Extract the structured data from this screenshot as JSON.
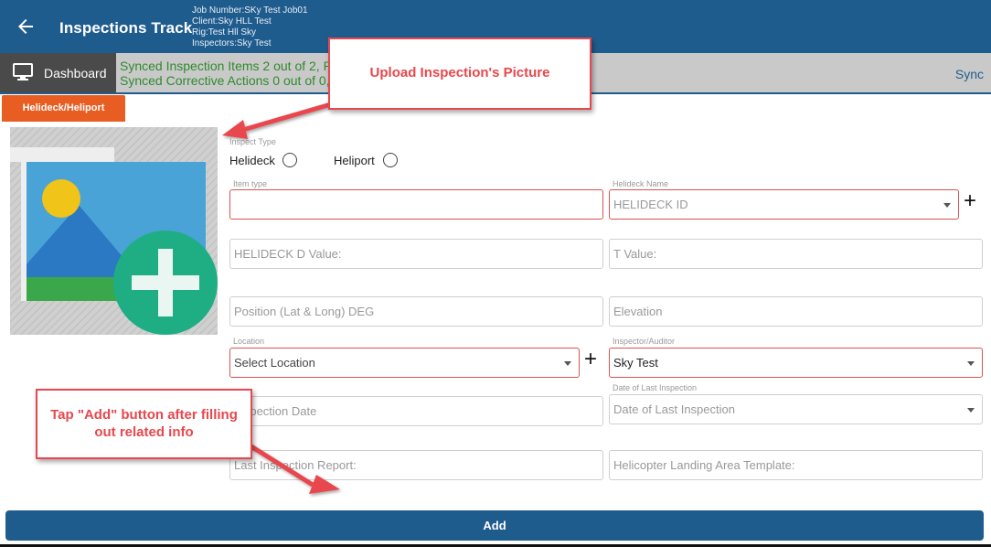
{
  "header": {
    "title": "Inspections Track",
    "job_number": "Job Number:SKy Test Job01",
    "client": "Client:Sky HLL Test",
    "rig": "Rig:Test Hll Sky",
    "inspectors": "Inspectors:Sky Test"
  },
  "syncbar": {
    "dashboard_label": "Dashboard",
    "synced_items": "Synced Inspection Items 2 out of 2, P",
    "synced_actions": "Synced Corrective Actions 0 out of 0,",
    "sync_link": "Sync"
  },
  "tabs": [
    {
      "label": "Helideck/Heliport",
      "active": true
    }
  ],
  "form": {
    "inspect_type_label": "Inspect Type",
    "radio_helideck": "Helideck",
    "radio_heliport": "Heliport",
    "item_type_label": "Item type",
    "item_type_value": "",
    "helideck_name_label": "Helideck Name",
    "helideck_name_value": "HELIDECK ID",
    "d_value_placeholder": "HELIDECK D Value:",
    "t_value_placeholder": "T Value:",
    "position_placeholder": "Position (Lat & Long) DEG",
    "elevation_placeholder": "Elevation",
    "location_label": "Location",
    "location_value": "Select Location",
    "inspector_label": "Inspector/Auditor",
    "inspector_value": "Sky Test",
    "inspection_date_placeholder": "Inspection Date",
    "last_inspection_label": "Date of Last Inspection",
    "last_inspection_value": "Date of Last Inspection",
    "last_report_placeholder": "Last Inspection Report:",
    "template_placeholder": "Helicopter Landing Area Template:"
  },
  "add_button_label": "Add",
  "callouts": {
    "upload": "Upload Inspection's Picture",
    "add_line1": "Tap \"Add\" button after filling",
    "add_line2": "out related info"
  },
  "colors": {
    "header_blue": "#1f5c8e",
    "tab_orange": "#e85d22",
    "sync_green": "#2f8a2f",
    "callout_red": "#e8474d",
    "required_red": "#d9534f",
    "add_icon_green": "#1fae84"
  },
  "icons": {
    "back": "back-arrow-icon",
    "dashboard": "monitor-icon",
    "photo": "image-add-icon",
    "add": "plus-icon"
  }
}
